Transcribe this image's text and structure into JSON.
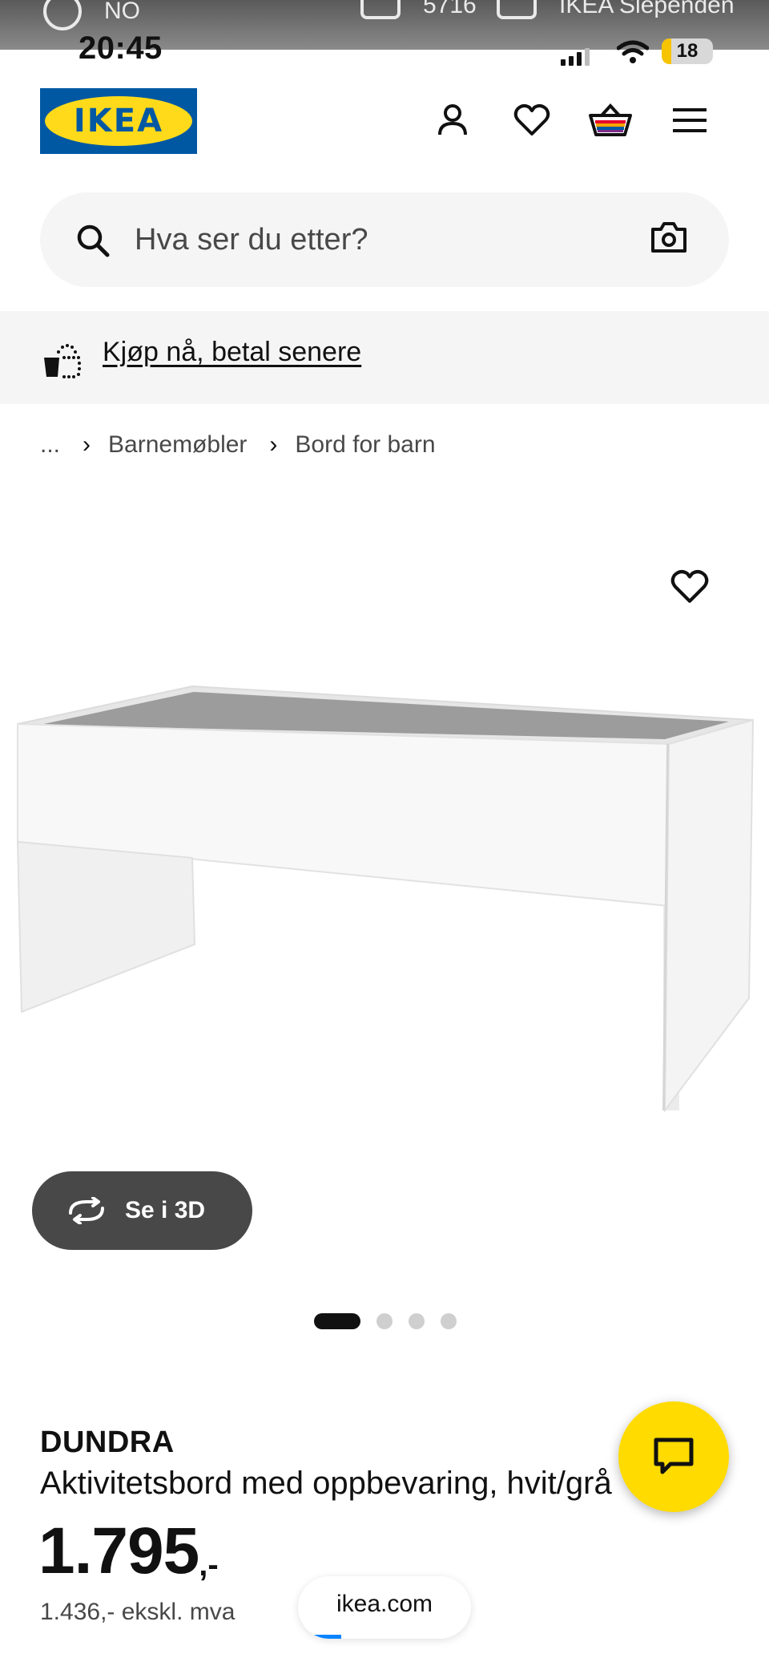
{
  "top_banner": {
    "region": "NO",
    "delivery_code": "5716",
    "store": "IKEA Slependen"
  },
  "status_bar": {
    "time": "20:45",
    "battery": "18",
    "battery_level": 0.18
  },
  "header": {
    "logo": "IKEA",
    "icons": [
      "user-icon",
      "heart-icon",
      "basket-icon",
      "menu-icon"
    ]
  },
  "search": {
    "placeholder": "Hva ser du etter?"
  },
  "promo": {
    "text": "Kjøp nå, betal senere"
  },
  "breadcrumb": {
    "ellipsis": "...",
    "items": [
      "Barnemøbler",
      "Bord for barn"
    ]
  },
  "product": {
    "name": "DUNDRA",
    "description": "Aktivitetsbord med oppbevaring, hvit/grå",
    "price_integer": "1.795",
    "price_suffix": ",-",
    "price_ex_vat": "1.436,- ekskl. mva",
    "see_3d_label": "Se i 3D",
    "gallery": {
      "total": 4,
      "active_index": 0
    }
  },
  "browser": {
    "url": "ikea.com",
    "load_progress": 0.25
  },
  "colors": {
    "ikea_blue": "#0058a3",
    "ikea_yellow": "#ffda1a",
    "chat_yellow": "#ffdb00",
    "dark_grey": "#484848"
  }
}
